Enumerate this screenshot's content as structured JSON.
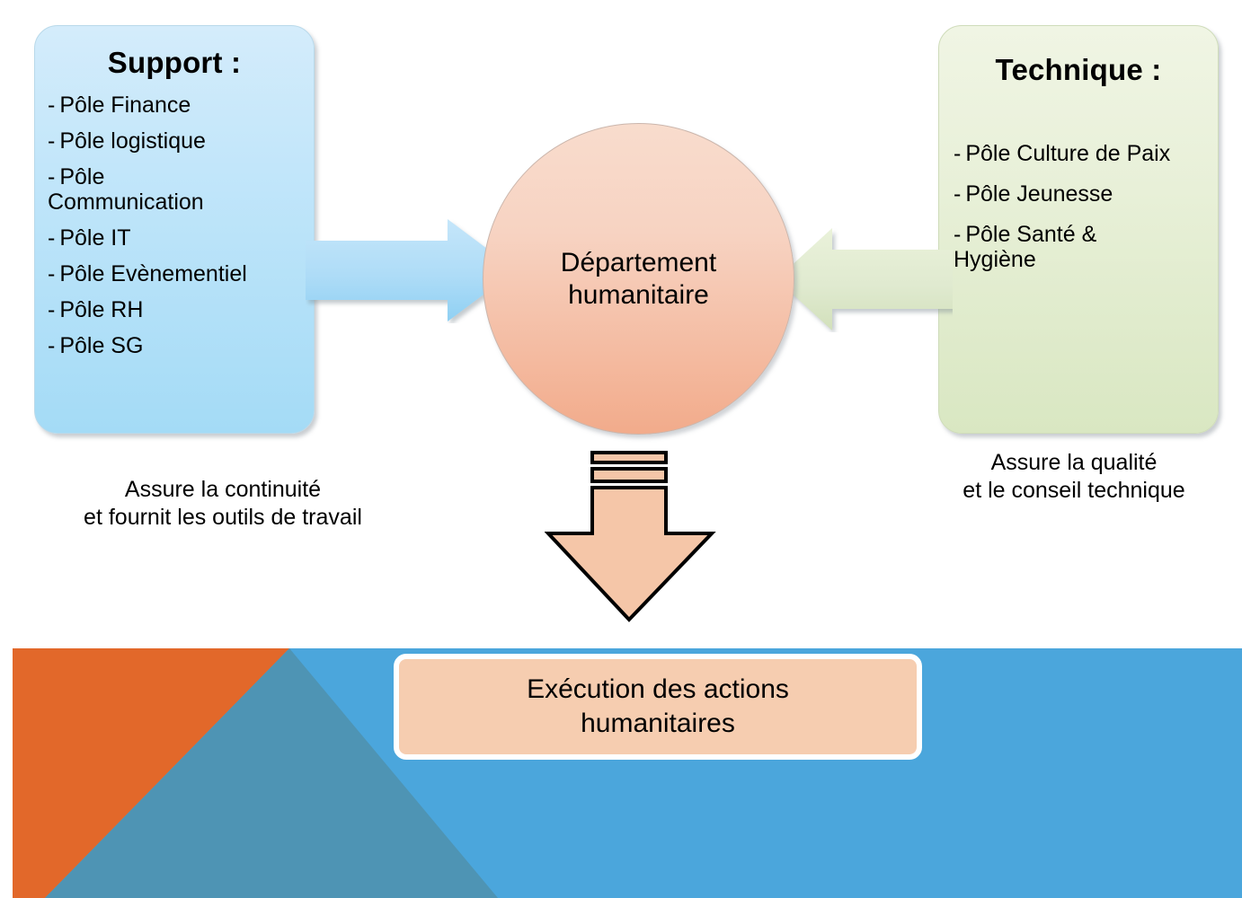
{
  "diagram": {
    "title_support": "Support :",
    "title_technique": "Technique :",
    "support_items": [
      "Pôle Finance",
      "Pôle logistique",
      "Pôle\nCommunication",
      "Pôle IT",
      "Pôle Evènementiel",
      "Pôle RH",
      "Pôle SG"
    ],
    "technique_items": [
      "Pôle Culture de Paix",
      "Pôle Jeunesse",
      "Pôle Santé &\nHygiène"
    ],
    "center_node": "Département\nhumanitaire",
    "support_caption": "Assure la continuité\net fournit les outils de travail",
    "technique_caption": "Assure la qualité\net le conseil technique",
    "execution_box": "Exécution des actions\nhumanitaires",
    "dash": "-",
    "arrows": {
      "support_to_center": "right-arrow-icon",
      "technique_to_center": "left-arrow-icon",
      "center_to_execution": "down-arrow-icon"
    },
    "colors": {
      "support_card_top": "#d4ecfb",
      "support_card_bottom": "#a4dbf6",
      "technique_card_top": "#f0f5e4",
      "technique_card_bottom": "#d9e7c2",
      "center_circle_top": "#f8dccd",
      "center_circle_bottom": "#f2ab8b",
      "execution_box_fill": "#f6cdb0",
      "arrow_blue": "#a9daf5",
      "arrow_green": "#dfeac6",
      "arrow_peach": "#f5c6a8",
      "banner_orange": "#e2682a",
      "banner_teal": "#4e94b4",
      "banner_blue": "#4ba6dc"
    }
  }
}
